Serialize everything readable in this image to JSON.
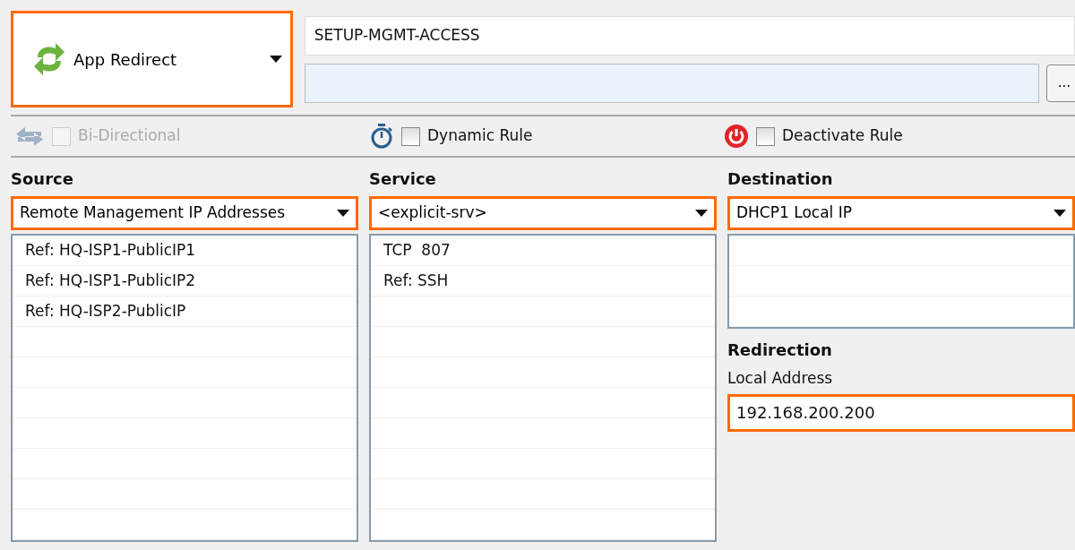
{
  "rule_type": {
    "label": "App Redirect",
    "highlighted": true
  },
  "rule_name": {
    "value": "SETUP-MGMT-ACCESS"
  },
  "description": {
    "browse_button": "..."
  },
  "options": [
    {
      "kind": "bidirectional",
      "label": "Bi-Directional",
      "checked": false,
      "disabled": true
    },
    {
      "kind": "dynamic",
      "label": "Dynamic Rule",
      "checked": false,
      "disabled": false
    },
    {
      "kind": "deactivate",
      "label": "Deactivate Rule",
      "checked": false,
      "disabled": false
    }
  ],
  "source": {
    "heading": "Source",
    "selector": {
      "value": "Remote Management IP Addresses",
      "highlighted": true
    },
    "items": [
      "Ref: HQ-ISP1-PublicIP1",
      "Ref: HQ-ISP1-PublicIP2",
      "Ref: HQ-ISP2-PublicIP"
    ]
  },
  "service": {
    "heading": "Service",
    "selector": {
      "value": "<explicit-srv>",
      "highlighted": true
    },
    "items": [
      "TCP  807",
      "Ref: SSH"
    ]
  },
  "destination": {
    "heading": "Destination",
    "selector": {
      "value": "DHCP1 Local IP",
      "highlighted": true
    }
  },
  "redirection": {
    "heading": "Redirection",
    "label": "Local Address",
    "value": "192.168.200.200",
    "highlighted": true
  }
}
